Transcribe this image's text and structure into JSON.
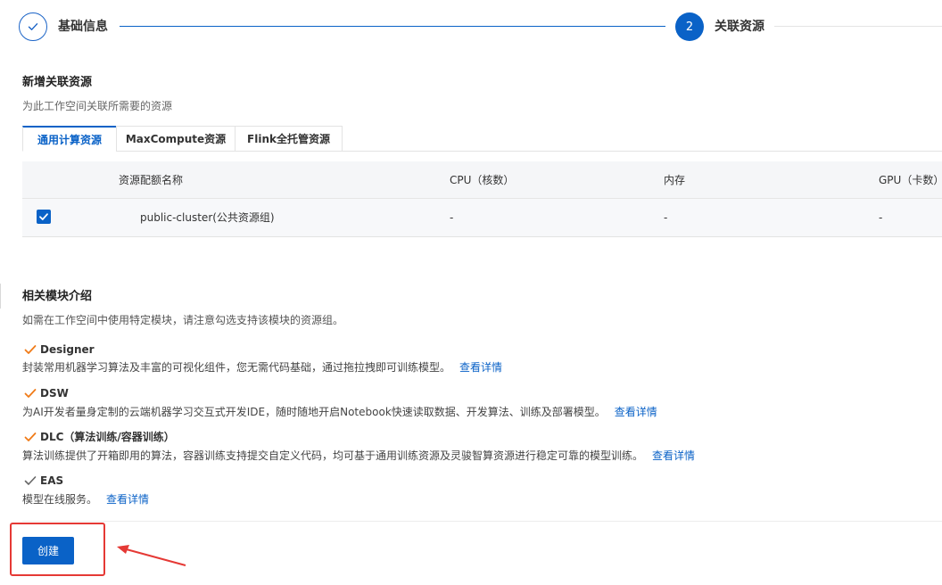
{
  "steps": [
    {
      "label": "基础信息",
      "status": "done"
    },
    {
      "number": "2",
      "label": "关联资源",
      "status": "active"
    }
  ],
  "resources": {
    "title": "新增关联资源",
    "description": "为此工作空间关联所需要的资源",
    "tabs": [
      {
        "label": "通用计算资源",
        "active": true
      },
      {
        "label": "MaxCompute资源",
        "active": false
      },
      {
        "label": "Flink全托管资源",
        "active": false
      }
    ],
    "table": {
      "columns": [
        "资源配额名称",
        "CPU（核数）",
        "内存",
        "GPU（卡数）"
      ],
      "rows": [
        {
          "checked": true,
          "name": "public-cluster(公共资源组)",
          "cpu": "-",
          "memory": "-",
          "gpu": "-"
        }
      ]
    }
  },
  "modules": {
    "title": "相关模块介绍",
    "description": "如需在工作空间中使用特定模块，请注意勾选支持该模块的资源组。",
    "items": [
      {
        "name": "Designer",
        "check_color": "#f07b18",
        "description": "封装常用机器学习算法及丰富的可视化组件，您无需代码基础，通过拖拉拽即可训练模型。",
        "link": "查看详情"
      },
      {
        "name": "DSW",
        "check_color": "#f07b18",
        "description": "为AI开发者量身定制的云端机器学习交互式开发IDE，随时随地开启Notebook快速读取数据、开发算法、训练及部署模型。",
        "link": "查看详情"
      },
      {
        "name": "DLC（算法训练/容器训练）",
        "check_color": "#f07b18",
        "description": "算法训练提供了开箱即用的算法，容器训练支持提交自定义代码，均可基于通用训练资源及灵骏智算资源进行稳定可靠的模型训练。",
        "link": "查看详情"
      },
      {
        "name": "EAS",
        "check_color": "#666666",
        "description": "模型在线服务。",
        "link": "查看详情"
      }
    ]
  },
  "footer": {
    "create_label": "创建"
  },
  "colors": {
    "primary": "#0a62c7",
    "annotation_red": "#e53935"
  }
}
